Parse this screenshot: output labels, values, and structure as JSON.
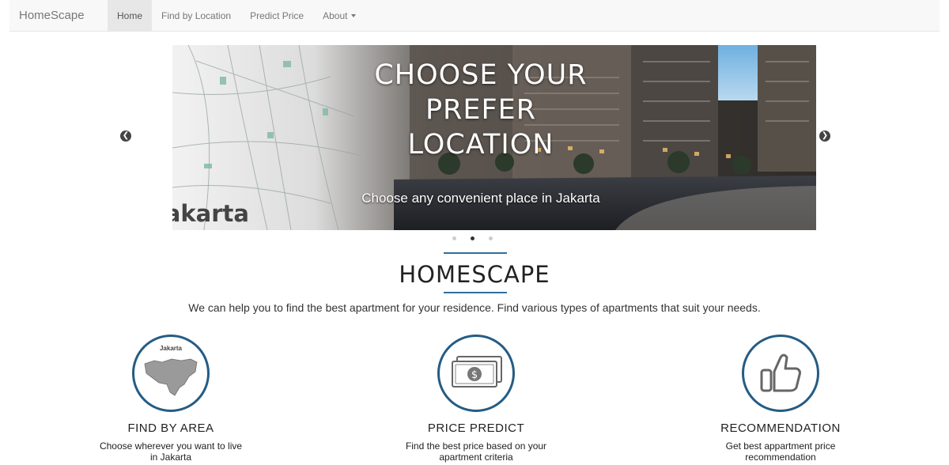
{
  "navbar": {
    "brand": "HomeScape",
    "items": [
      {
        "label": "Home",
        "active": true
      },
      {
        "label": "Find by Location",
        "active": false
      },
      {
        "label": "Predict Price",
        "active": false
      },
      {
        "label": "About",
        "active": false,
        "dropdown": true
      }
    ]
  },
  "carousel": {
    "heading_line1": "CHOOSE YOUR PREFER",
    "heading_line2": "LOCATION",
    "caption": "Choose any convenient place in Jakarta",
    "city_label": "Jakarta",
    "prev_icon": "chevron-left-icon",
    "next_icon": "chevron-right-icon",
    "slide_count": 3,
    "active_slide": 2
  },
  "section": {
    "title": "HOMESCAPE",
    "intro": "We can help you to find the best apartment for your residence. Find various types of apartments that suit your needs.",
    "accent_color": "#2e6f9e"
  },
  "features": [
    {
      "icon": "jakarta-map-icon",
      "icon_label": "Jakarta",
      "title": "FIND BY AREA",
      "desc_line1": "Choose wherever you want to live",
      "desc_line2": "in Jakarta"
    },
    {
      "icon": "money-icon",
      "title": "PRICE PREDICT",
      "desc_line1": "Find the best price based on your",
      "desc_line2": "apartment criteria"
    },
    {
      "icon": "thumbs-up-icon",
      "title": "RECOMMENDATION",
      "desc_line1": "Get best appartment price",
      "desc_line2": "recommendation"
    }
  ]
}
